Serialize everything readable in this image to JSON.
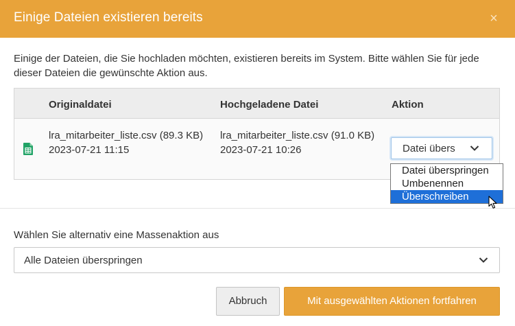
{
  "dialog": {
    "title": "Einige Dateien existieren bereits",
    "close_symbol": "×",
    "description": "Einige der Dateien, die Sie hochladen möchten, existieren bereits im System. Bitte wählen Sie für jede dieser Dateien die gewünschte Aktion aus."
  },
  "table": {
    "headers": {
      "original": "Originaldatei",
      "uploaded": "Hochgeladene Datei",
      "action": "Aktion"
    },
    "rows": [
      {
        "icon": "spreadsheet-file-icon",
        "original_name": "lra_mitarbeiter_liste.csv (89.3 KB)",
        "original_date": "2023-07-21 11:15",
        "uploaded_name": "lra_mitarbeiter_liste.csv (91.0 KB)",
        "uploaded_date": "2023-07-21 10:26",
        "action_value": "Datei übers"
      }
    ]
  },
  "action_dropdown": {
    "options": [
      "Datei überspringen",
      "Umbenennen",
      "Überschreiben"
    ],
    "highlighted_index": 2
  },
  "mass_action": {
    "label": "Wählen Sie alternativ eine Massenaktion aus",
    "value": "Alle Dateien überspringen"
  },
  "buttons": {
    "cancel": "Abbruch",
    "continue": "Mit ausgewählten Aktionen fortfahren"
  },
  "colors": {
    "accent": "#e8a33a",
    "selection": "#1e6fd8",
    "csv_icon": "#21a366"
  }
}
